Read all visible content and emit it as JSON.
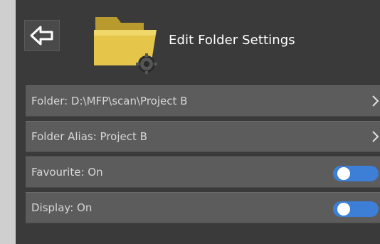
{
  "header": {
    "title": "Edit Folder Settings",
    "back_icon": "back-arrow-icon",
    "folder_icon": "folder-settings-icon"
  },
  "settings": {
    "items": [
      {
        "label": "Folder: D:\\MFP\\scan\\Project B",
        "kind": "navigate",
        "icon": "chevron-right-icon"
      },
      {
        "label": "Folder Alias: Project B",
        "kind": "navigate",
        "icon": "chevron-right-icon"
      },
      {
        "label": "Favourite: On",
        "kind": "toggle",
        "state": "on"
      },
      {
        "label": "Display: On",
        "kind": "toggle",
        "state": "on"
      }
    ]
  },
  "colors": {
    "panel_bg": "#3a3a3a",
    "row_bg": "#5c5c5c",
    "toggle_on": "#3d7fd6",
    "folder_yellow": "#e6c64a"
  }
}
